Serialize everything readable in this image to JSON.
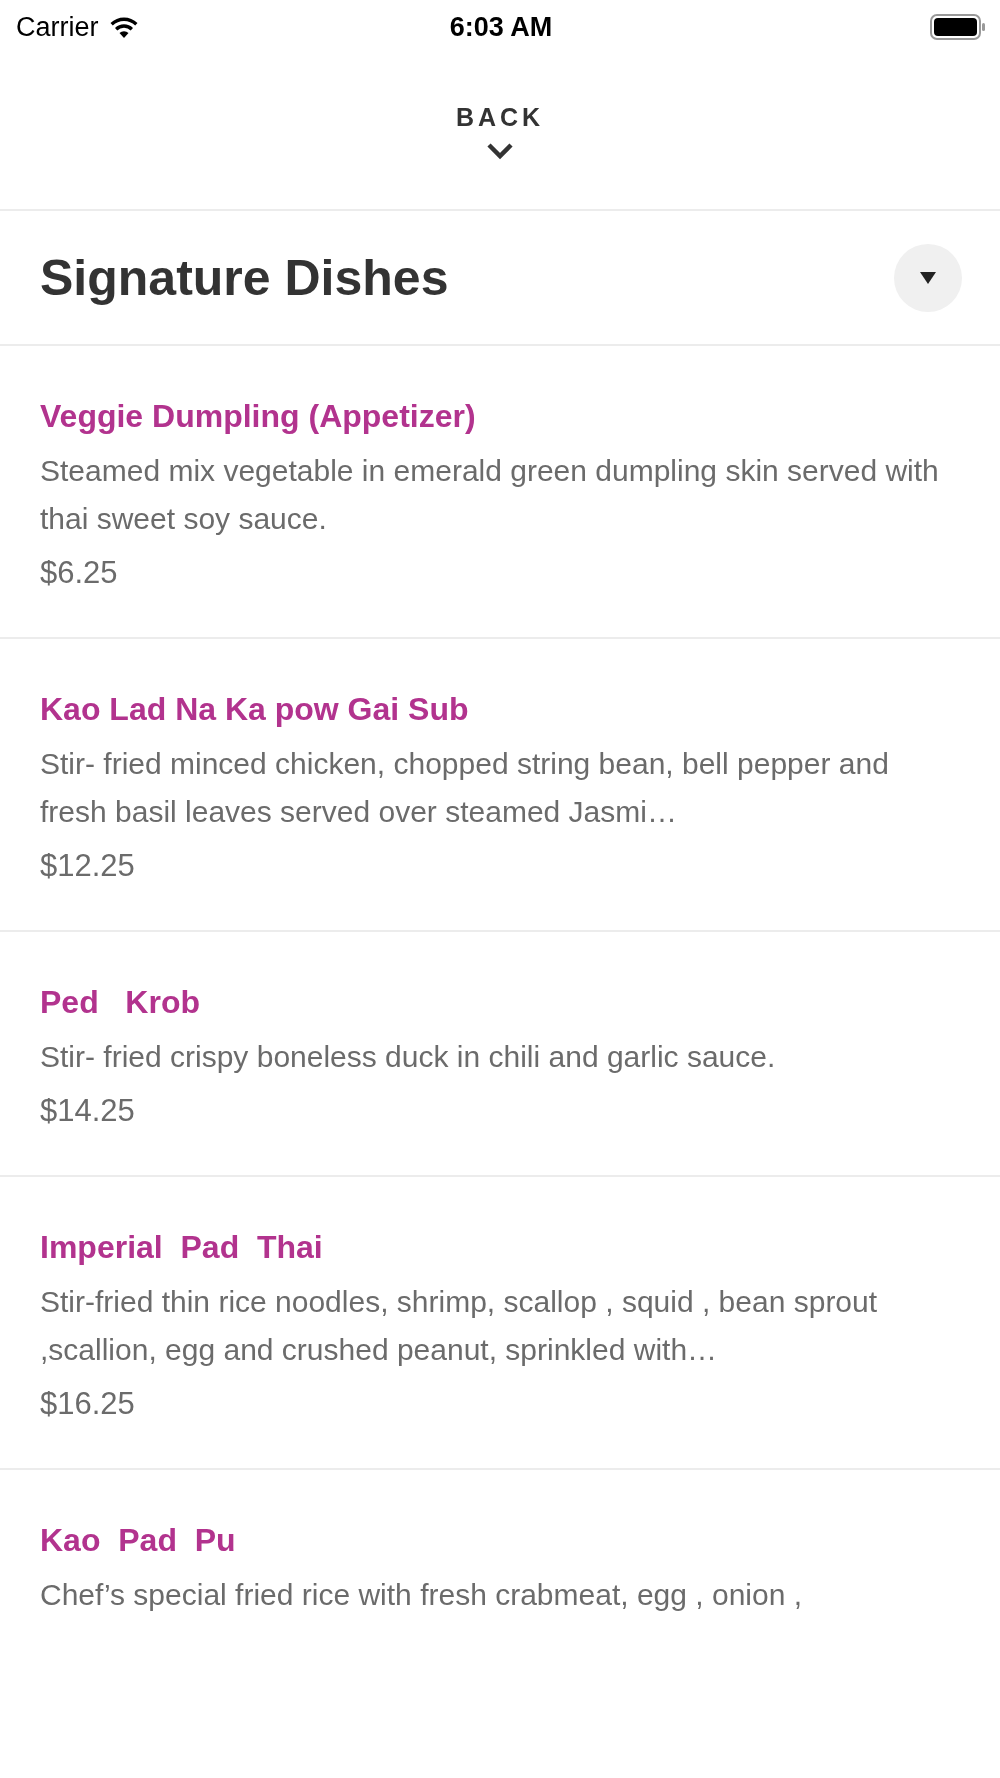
{
  "status_bar": {
    "carrier": "Carrier",
    "time": "6:03 AM"
  },
  "back": {
    "label": "BACK"
  },
  "section": {
    "title": "Signature Dishes",
    "expanded": false
  },
  "dishes": [
    {
      "name": "Veggie Dumpling (Appetizer)",
      "description": "Steamed mix vegetable in emerald green dumpling skin served with thai sweet soy sauce.",
      "price": "$6.25"
    },
    {
      "name": "Kao Lad Na Ka pow Gai Sub",
      "description": "Stir- fried minced chicken, chopped string bean, bell pepper and fresh basil leaves served over steamed Jasmi…",
      "price": "$12.25"
    },
    {
      "name": "Ped   Krob",
      "description": "Stir- fried crispy boneless duck in chili and garlic sauce.",
      "price": "$14.25"
    },
    {
      "name": "Imperial  Pad  Thai",
      "description": "Stir-fried thin rice noodles, shrimp, scallop , squid , bean sprout ,scallion, egg and crushed peanut, sprinkled with…",
      "price": "$16.25"
    },
    {
      "name": "Kao  Pad  Pu",
      "description": "Chef’s special fried rice with fresh crabmeat, egg , onion ,"
    }
  ]
}
